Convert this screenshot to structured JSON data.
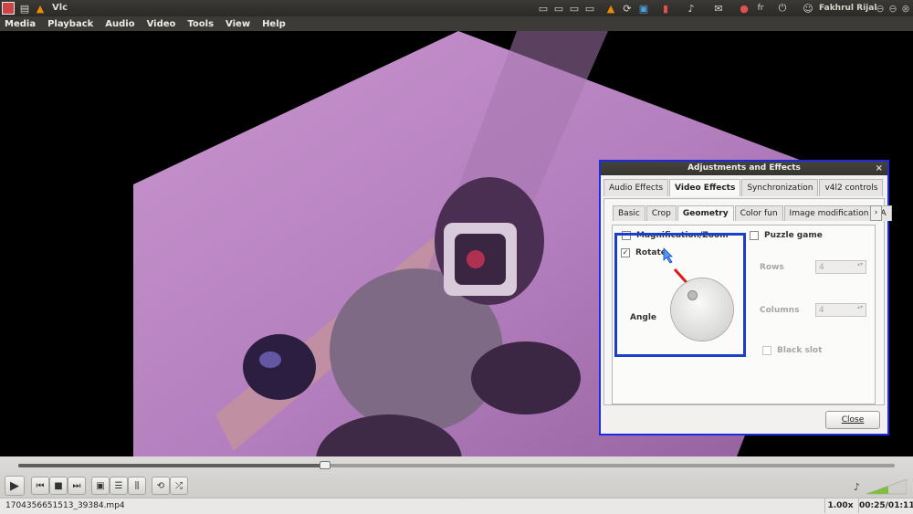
{
  "top_panel": {
    "app_title": "Vlc",
    "keyboard_layout": "fr",
    "user_name": "Fakhrul Rijal"
  },
  "menu": {
    "items": [
      "Media",
      "Playback",
      "Audio",
      "Video",
      "Tools",
      "View",
      "Help"
    ]
  },
  "dialog": {
    "title": "Adjustments and Effects",
    "close_icon": "×",
    "main_tabs": [
      "Audio Effects",
      "Video Effects",
      "Synchronization",
      "v4l2 controls"
    ],
    "active_main_tab": "Video Effects",
    "sub_tabs": [
      "Basic",
      "Crop",
      "Geometry",
      "Color fun",
      "Image modification",
      "A"
    ],
    "active_sub_tab": "Geometry",
    "magnification_label": "Magnification/Zoom",
    "magnification_checked": false,
    "rotate_label": "Rotate",
    "rotate_checked": true,
    "angle_label": "Angle",
    "puzzle_label": "Puzzle game",
    "puzzle_checked": false,
    "rows_label": "Rows",
    "rows_value": "4",
    "columns_label": "Columns",
    "columns_value": "4",
    "black_slot_label": "Black slot",
    "close_button": "Close"
  },
  "player": {
    "filename": "1704356651513_39384.mp4",
    "speed": "1.00x",
    "time": "00:25/01:11",
    "progress": 0.35
  },
  "colors": {
    "accent_blue": "#1a3fc9",
    "annotation_arrow": "#e01818"
  }
}
